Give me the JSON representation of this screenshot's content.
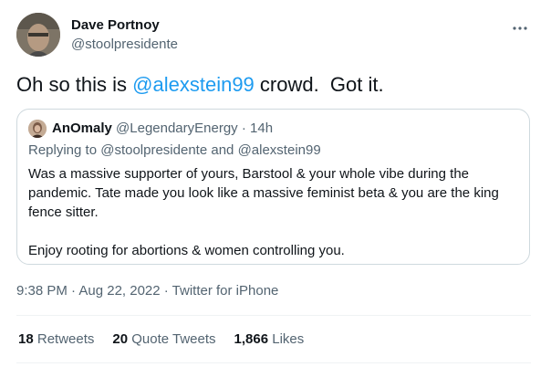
{
  "author": {
    "display_name": "Dave Portnoy",
    "handle": "@stoolpresidente"
  },
  "tweet": {
    "text_before": "Oh so this is ",
    "mention": "@alexstein99",
    "text_after": " crowd.  Got it."
  },
  "quoted": {
    "name": "AnOmaly",
    "handle": "@LegendaryEnergy",
    "separator": "·",
    "time": "14h",
    "replying_prefix": "Replying to ",
    "replying_user1": "@stoolpresidente",
    "replying_and": " and ",
    "replying_user2": "@alexstein99",
    "paragraph1": "Was a massive supporter of yours, Barstool & your whole vibe during the pandemic. Tate made you look like a massive feminist beta & you are the king fence sitter.",
    "paragraph2": "Enjoy rooting for abortions & women controlling you."
  },
  "meta": {
    "timestamp": "9:38 PM · Aug 22, 2022 · Twitter for iPhone"
  },
  "stats": {
    "retweets_count": "18",
    "retweets_label": "Retweets",
    "quotes_count": "20",
    "quotes_label": "Quote Tweets",
    "likes_count": "1,866",
    "likes_label": "Likes"
  },
  "colors": {
    "link": "#1d9bf0",
    "secondary": "#536471",
    "border": "#cfd9de"
  },
  "icons": {
    "more": "more-horizontal-icon"
  }
}
